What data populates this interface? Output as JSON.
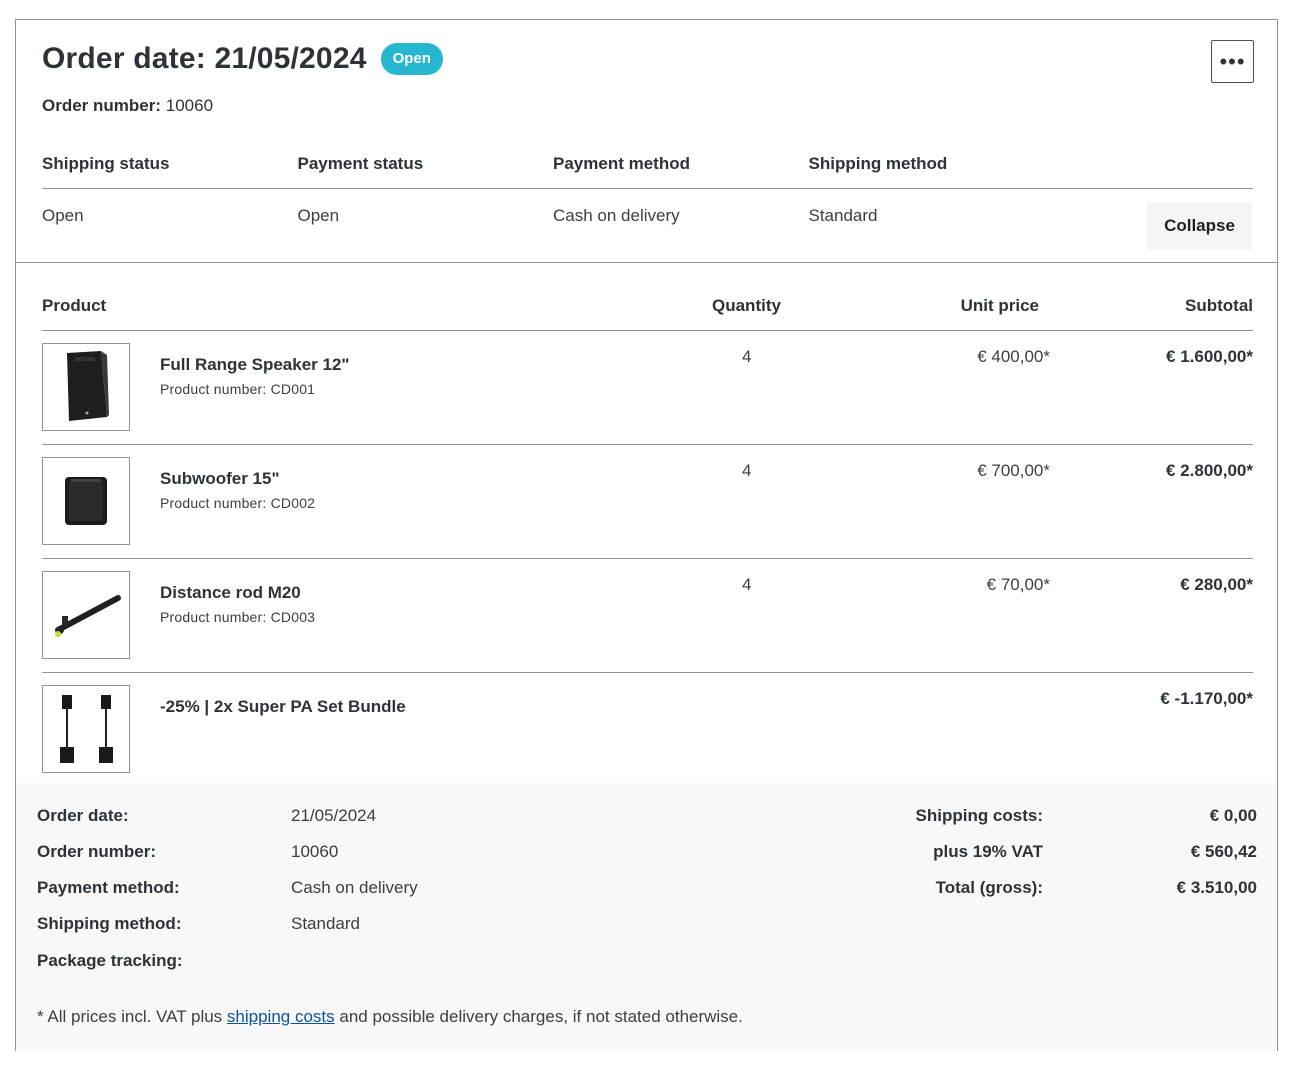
{
  "header": {
    "title": "Order date: 21/05/2024",
    "badge": "Open",
    "order_number_label": "Order number:",
    "order_number_value": "10060",
    "more_label": "•••"
  },
  "status": {
    "columns": [
      "Shipping status",
      "Payment status",
      "Payment method",
      "Shipping method"
    ],
    "values": [
      "Open",
      "Open",
      "Cash on delivery",
      "Standard"
    ],
    "collapse_label": "Collapse"
  },
  "products": {
    "columns": {
      "product": "Product",
      "quantity": "Quantity",
      "unit_price": "Unit price",
      "subtotal": "Subtotal"
    },
    "items": [
      {
        "name": "Full Range Speaker 12\"",
        "number": "Product number: CD001",
        "quantity": "4",
        "unit_price": "€ 400,00*",
        "subtotal": "€ 1.600,00*",
        "icon": "speaker-icon"
      },
      {
        "name": "Subwoofer 15\"",
        "number": "Product number: CD002",
        "quantity": "4",
        "unit_price": "€ 700,00*",
        "subtotal": "€ 2.800,00*",
        "icon": "subwoofer-icon"
      },
      {
        "name": "Distance rod M20",
        "number": "Product number: CD003",
        "quantity": "4",
        "unit_price": "€ 70,00*",
        "subtotal": "€ 280,00*",
        "icon": "rod-icon"
      },
      {
        "name": "-25% | 2x Super PA Set Bundle",
        "subtotal": "€ -1.170,00*",
        "icon": "pa-set-icon"
      }
    ]
  },
  "summary": {
    "details": [
      {
        "label": "Order date:",
        "value": "21/05/2024"
      },
      {
        "label": "Order number:",
        "value": "10060"
      },
      {
        "label": "Payment method:",
        "value": "Cash on delivery"
      },
      {
        "label": "Shipping method:",
        "value": "Standard"
      },
      {
        "label": "Package tracking:",
        "value": ""
      }
    ],
    "totals": [
      {
        "label": "Shipping costs:",
        "value": "€ 0,00"
      },
      {
        "label": "plus 19% VAT",
        "value": "€ 560,42"
      },
      {
        "label": "Total (gross):",
        "value": "€ 3.510,00"
      }
    ],
    "footnote_before": "* All prices incl. VAT plus ",
    "footnote_link": "shipping costs",
    "footnote_after": " and possible delivery charges, if not stated otherwise."
  },
  "colors": {
    "badge": "#26b6cf",
    "link": "#0b539b",
    "summary_bg": "#f8f8f8",
    "border": "#8f9296"
  }
}
